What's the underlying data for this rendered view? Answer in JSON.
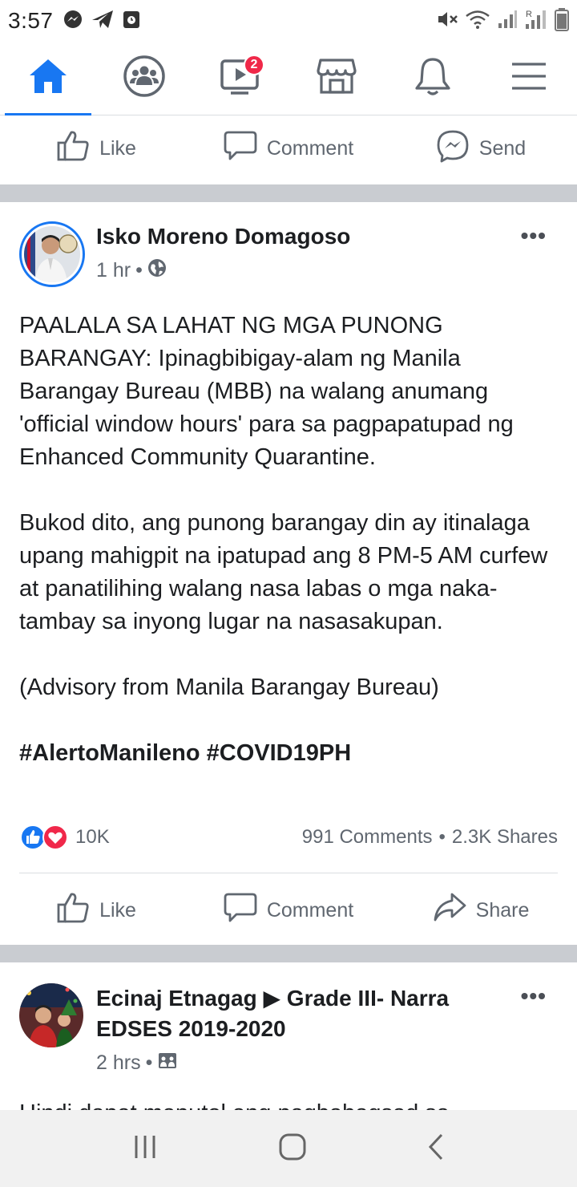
{
  "status_bar": {
    "time": "3:57"
  },
  "nav": {
    "tabs": [
      {
        "icon": "home-icon",
        "active": true
      },
      {
        "icon": "groups-icon",
        "active": false
      },
      {
        "icon": "watch-icon",
        "active": false,
        "badge": "2"
      },
      {
        "icon": "marketplace-icon",
        "active": false
      },
      {
        "icon": "bell-icon",
        "active": false
      },
      {
        "icon": "menu-icon",
        "active": false
      }
    ]
  },
  "top_actions": {
    "like": "Like",
    "comment": "Comment",
    "send": "Send"
  },
  "post1": {
    "author": "Isko Moreno Domagoso",
    "time": "1 hr",
    "paragraphs": [
      "PAALALA SA LAHAT NG MGA PUNONG BARANGAY: Ipinagbibigay-alam ng Manila Barangay Bureau (MBB) na walang anumang 'official window hours' para sa pagpapatupad ng Enhanced Community Quarantine.",
      "Bukod dito, ang punong barangay din ay itinalaga upang mahigpit na ipatupad ang 8 PM-5 AM curfew at panatilihing walang nasa labas o mga naka-tambay sa inyong lugar na nasasakupan.",
      "(Advisory from Manila Barangay Bureau)"
    ],
    "hashtags": "#AlertoManileno #COVID19PH",
    "reaction_count": "10K",
    "comments": "991 Comments",
    "shares": "2.3K Shares",
    "actions": {
      "like": "Like",
      "comment": "Comment",
      "share": "Share"
    }
  },
  "post2": {
    "author_line1": "Ecinaj Etnagag ▶ Grade III- Narra",
    "author_line2": "EDSES 2019-2020",
    "time": "2 hrs",
    "body_partial": "Hindi dapat maputol ang pagbabagsad sa"
  },
  "colors": {
    "accent": "#1877f2",
    "badge": "#f02849",
    "band": "#c9ccd1",
    "secondary_text": "#606770"
  }
}
